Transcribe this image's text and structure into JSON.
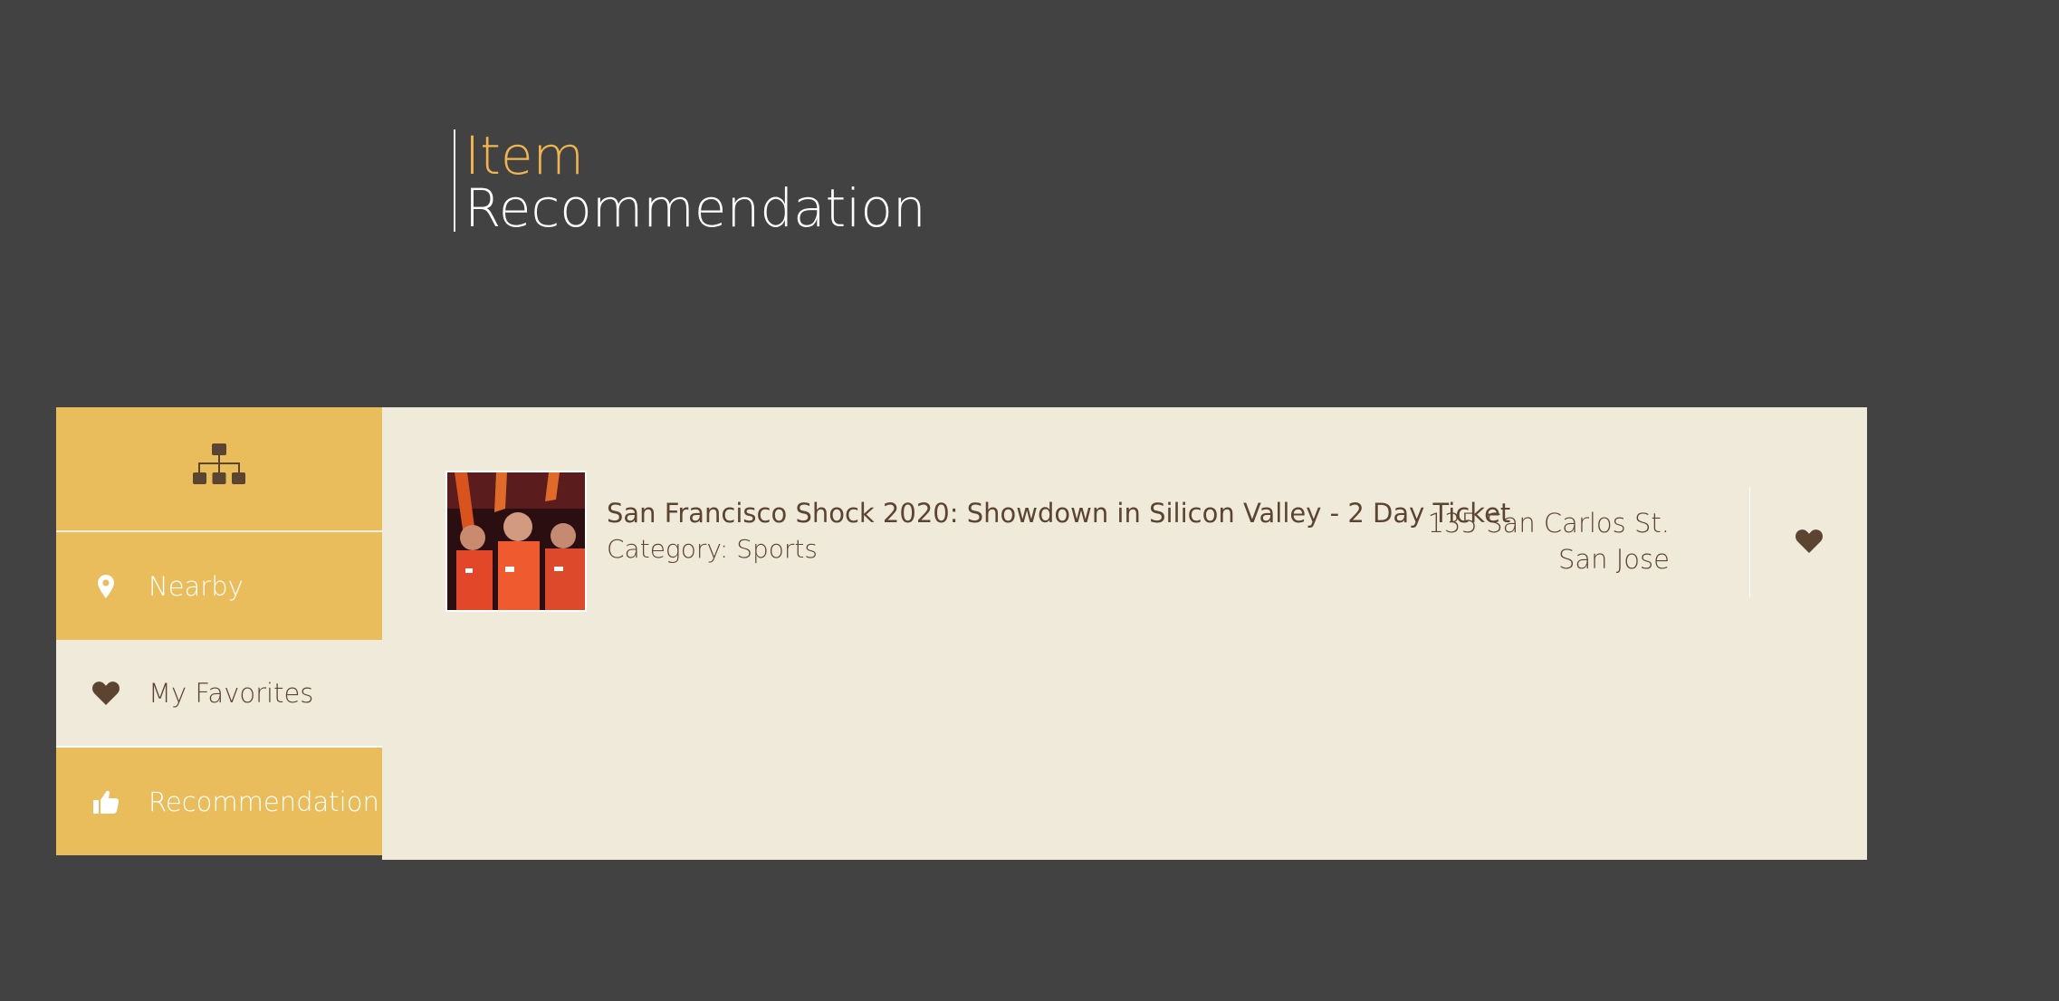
{
  "header": {
    "title_accent": "Item",
    "title_main": "Recommendation"
  },
  "sidebar": {
    "header_icon": "sitemap-icon",
    "items": [
      {
        "label": "Nearby",
        "icon": "map-pin-icon",
        "active": false
      },
      {
        "label": "My Favorites",
        "icon": "heart-icon",
        "active": true
      },
      {
        "label": "Recommendation",
        "icon": "thumbs-up-icon",
        "active": false
      }
    ]
  },
  "items": [
    {
      "name": "San Francisco Shock 2020: Showdown in Silicon Valley - 2 Day Ticket",
      "category": "Category: Sports",
      "address_line1": "135 San Carlos St.",
      "address_line2": "San Jose",
      "favorite_icon": "heart-icon"
    }
  ],
  "colors": {
    "background": "#424242",
    "accent": "#f0b550",
    "sidebar_gold": "#eabd5c",
    "content_bg": "#f0eadb",
    "text_brown": "#5b4430"
  }
}
